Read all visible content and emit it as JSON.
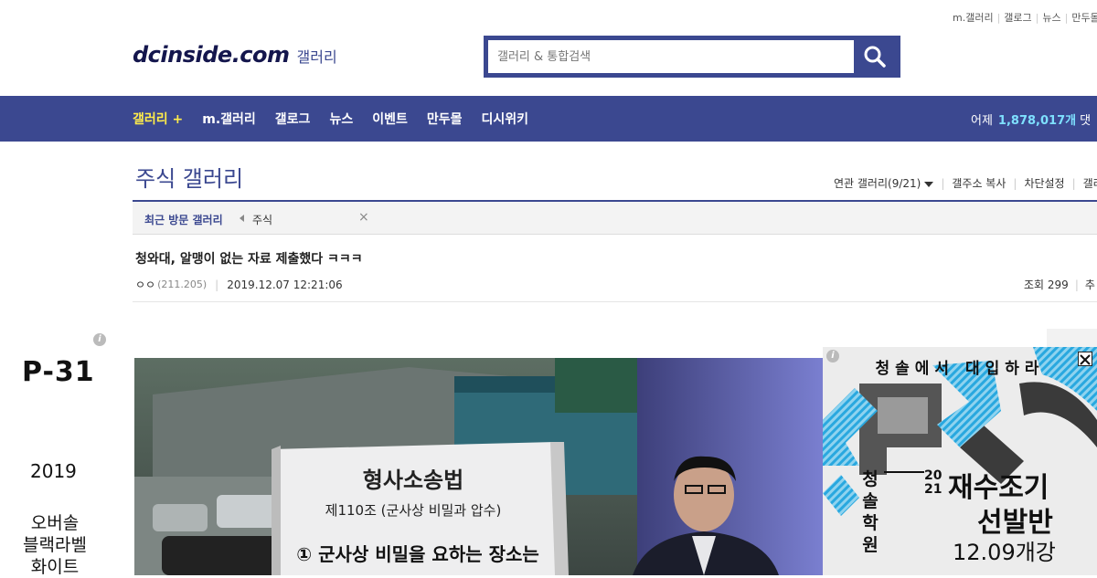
{
  "util_links": [
    "m.갤러리",
    "갤로그",
    "뉴스",
    "만두몰"
  ],
  "logo": {
    "main": "dcinside.com",
    "sub": "갤러리"
  },
  "search": {
    "placeholder": "갤러리 & 통합검색"
  },
  "nav": {
    "items": [
      "갤러리 +",
      "m.갤러리",
      "갤로그",
      "뉴스",
      "이벤트",
      "만두몰",
      "디시위키"
    ],
    "stats_label": "어제",
    "stats_value": "1,878,017개",
    "stats_tail": "댓"
  },
  "gallery": {
    "title": "주식 갤러리",
    "tools": [
      "연관 갤러리(9/21)",
      "갤주소 복사",
      "차단설정",
      "갤러"
    ],
    "recent_label": "최근 방문 갤러리",
    "recent_item": "주식",
    "recent_close": "×"
  },
  "post": {
    "title": "청와대, 알맹이 없는 자료 제출했다 ㅋㅋㅋ",
    "author": "ㅇㅇ",
    "ip": "(211.205)",
    "date": "2019.12.07 12:21:06",
    "views": "조회 299",
    "more": "추"
  },
  "left_ad": {
    "info": "i",
    "model": "P-31",
    "year": "2019",
    "lines": [
      "오버솔",
      "블랙라벨",
      "화이트"
    ]
  },
  "main_image": {
    "book_title": "형사소송법",
    "book_article": "제110조 (군사상 비밀과 압수)",
    "book_clause": "① 군사상 비밀을 요하는 장소는"
  },
  "right_ad": {
    "info": "i",
    "headline": "청솔에서 대입하라",
    "school_chars": [
      "청",
      "솔",
      "학",
      "원"
    ],
    "year_top": "20",
    "year_bottom": "21",
    "title_line1": "재수조기",
    "title_line2": "선발반",
    "date": "12.09개강"
  },
  "colors": {
    "brand": "#3b4890",
    "nav_active": "#ffed4a",
    "stats_number": "#7ee0ff"
  }
}
